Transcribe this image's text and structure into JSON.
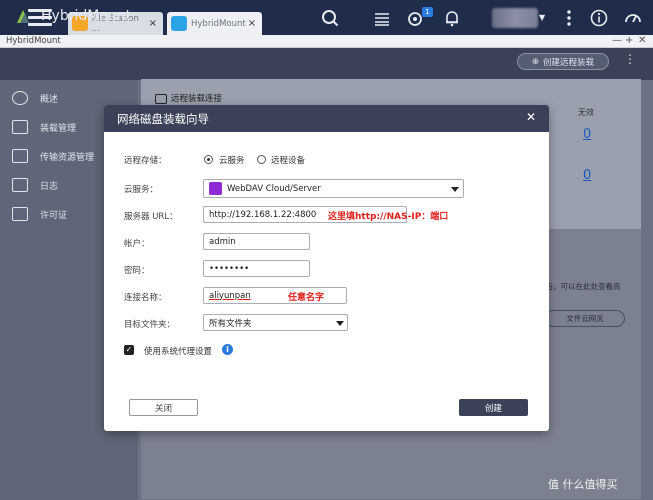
{
  "qts": {
    "tabs": [
      {
        "label": "File Station ...",
        "close": "×",
        "icon_color": "#f4a62a"
      },
      {
        "label": "HybridMount",
        "close": "×",
        "icon_color": "#2aa4e6"
      }
    ],
    "notification_count": "1"
  },
  "app": {
    "window_title": "HybridMount",
    "name": "HybridMount",
    "window_controls": [
      "—",
      "+",
      "✕"
    ],
    "create_button": "创建远程装载",
    "more": "⋮"
  },
  "sidebar": {
    "items": [
      {
        "label": "概述",
        "icon": "overview-icon"
      },
      {
        "label": "装载管理",
        "icon": "mount-icon"
      },
      {
        "label": "传输资源管理",
        "icon": "transfer-icon"
      },
      {
        "label": "日志",
        "icon": "log-icon"
      },
      {
        "label": "许可证",
        "icon": "license-icon"
      }
    ]
  },
  "main": {
    "panel_title": "远程装载连接",
    "col_fail": "无效",
    "fail_counts": [
      "0",
      "0"
    ],
    "side_text": "关后，可以在此处查看高",
    "side_button": "文件云网关"
  },
  "dialog": {
    "title": "网络磁盘装载向导",
    "close": "✕",
    "remote_storage_label": "远程存储：",
    "radio_cloud": "云服务",
    "radio_remote": "远程设备",
    "cloud_service_label": "云服务：",
    "cloud_service_value": "WebDAV Cloud/Server",
    "server_url_label": "服务器 URL：",
    "server_url_value": "http://192.168.1.22:4800",
    "server_url_note": "这里填http://NAS-IP：端口",
    "account_label": "帐户：",
    "account_value": "admin",
    "password_label": "密码：",
    "password_value": "••••••••",
    "conn_name_label": "连接名称：",
    "conn_name_value": "aliyunpan",
    "conn_name_note": "任意名字",
    "target_folder_label": "目标文件夹：",
    "target_folder_value": "所有文件夹",
    "proxy_label": "使用系统代理设置",
    "cancel_button": "关闭",
    "create_button": "创建"
  },
  "watermark": "值 什么值得买",
  "colors": {
    "topbar": "#1f2c4a",
    "header": "#3b4257",
    "annotation": "#e0201b",
    "link": "#1b57c4"
  }
}
